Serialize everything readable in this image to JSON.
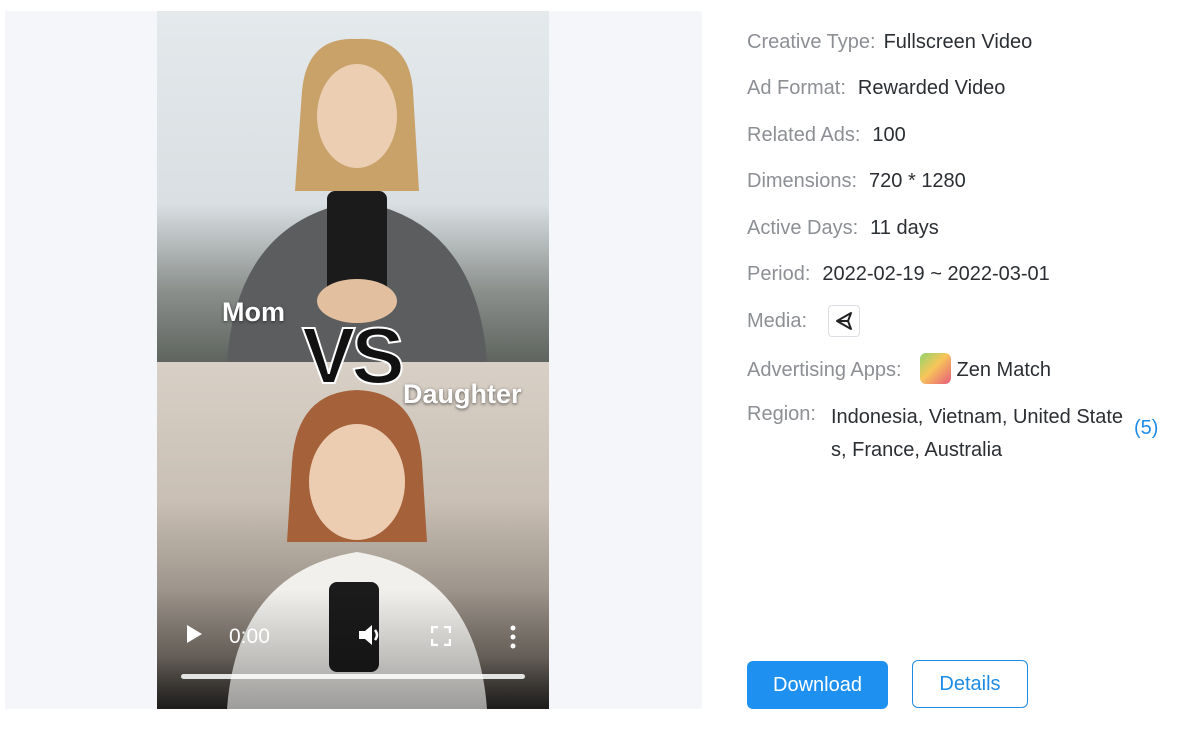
{
  "video": {
    "overlay_mom": "Mom",
    "overlay_vs": "VS",
    "overlay_daughter": "Daughter",
    "time": "0:00",
    "progress": 0
  },
  "details": {
    "creative_type_label": "Creative Type:",
    "creative_type_value": "Fullscreen Video",
    "ad_format_label": "Ad Format:",
    "ad_format_value": "Rewarded Video",
    "related_ads_label": "Related Ads:",
    "related_ads_value": "100",
    "dimensions_label": "Dimensions:",
    "dimensions_value": "720 * 1280",
    "active_days_label": "Active Days:",
    "active_days_value": "11 days",
    "period_label": "Period:",
    "period_value": "2022-02-19 ~ 2022-03-01",
    "media_label": "Media:",
    "media_icon": "unity-icon",
    "advertising_apps_label": "Advertising Apps:",
    "advertising_app_name": "Zen Match",
    "region_label": "Region:",
    "region_value": "Indonesia, Vietnam, United States, France, Australia",
    "region_count": "(5)"
  },
  "actions": {
    "download_label": "Download",
    "details_label": "Details"
  },
  "colors": {
    "accent": "#1e90f0",
    "label": "#8c8f94",
    "value": "#2b2f33"
  }
}
